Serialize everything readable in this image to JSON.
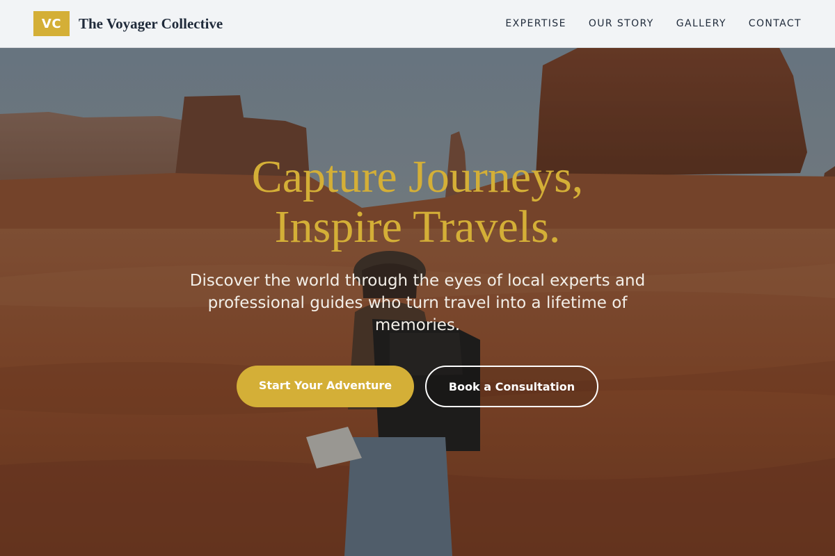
{
  "header": {
    "logo_initials": "VC",
    "brand_name": "The Voyager Collective",
    "nav": [
      {
        "label": "EXPERTISE"
      },
      {
        "label": "OUR STORY"
      },
      {
        "label": "GALLERY"
      },
      {
        "label": "CONTACT"
      }
    ]
  },
  "hero": {
    "headline_line1": "Capture Journeys,",
    "headline_line2": "Inspire Travels.",
    "subheadline": "Discover the world through the eyes of local experts and professional guides who turn travel into a lifetime of memories.",
    "primary_cta": "Start Your Adventure",
    "secondary_cta": "Book a Consultation",
    "background_image": "desert-butte-traveler-photo"
  },
  "colors": {
    "accent_gold": "#d4af37",
    "header_bg": "#f2f4f6",
    "brand_text": "#1f2a3a"
  }
}
